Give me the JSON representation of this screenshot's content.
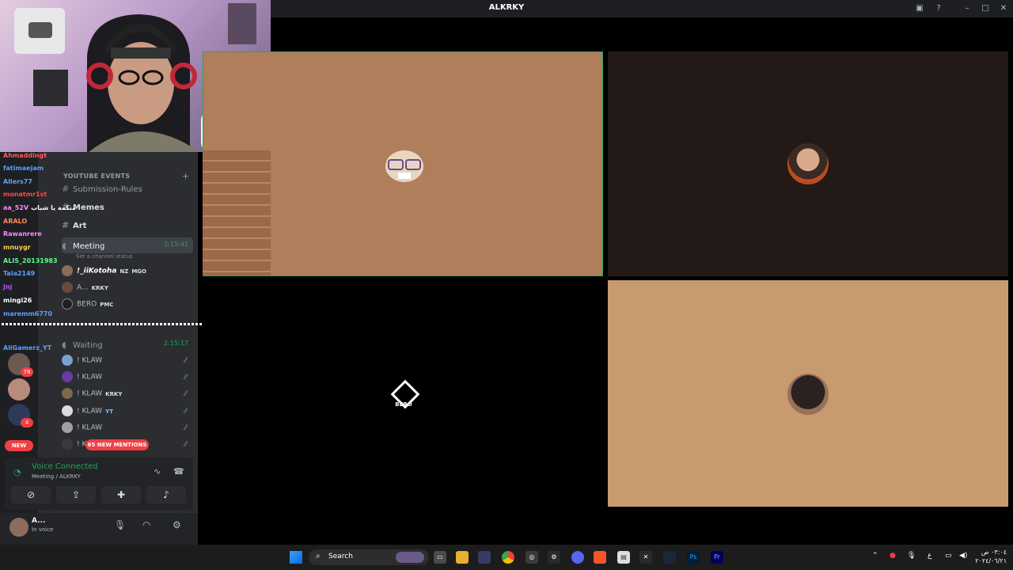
{
  "window": {
    "title": "ALKRKY"
  },
  "sidebar": {
    "category": "YOUTUBE EVENTS",
    "channels": [
      {
        "name": "Submission-Rules",
        "type": "text"
      },
      {
        "name": "Memes",
        "type": "text"
      },
      {
        "name": "Art",
        "type": "text"
      },
      {
        "name": "Meeting",
        "type": "voice",
        "time": "2:15:41"
      },
      {
        "name": "Waiting",
        "type": "voice",
        "time": "2:15:17"
      }
    ],
    "channel_status": "Set a channel status",
    "meeting_users": [
      {
        "name": "!_iiKotoha",
        "tags": "NZ",
        "role": "MGO"
      },
      {
        "name": "A...",
        "role": "KRKY"
      },
      {
        "name": "BERO",
        "role": "PMC"
      }
    ],
    "waiting_users": [
      {
        "name": "! KLAW",
        "role": ""
      },
      {
        "name": "! KLAW",
        "role": ""
      },
      {
        "name": "! KLAW",
        "role": "KRKY"
      },
      {
        "name": "! KLAW",
        "role": "YT"
      },
      {
        "name": "! KLAW",
        "role": ""
      },
      {
        "name": "! KL",
        "role": ""
      }
    ],
    "server_badges": [
      "78",
      "4"
    ],
    "new_label": "NEW",
    "mentions_label": "65 NEW MENTIONS"
  },
  "voice": {
    "status": "Voice Connected",
    "location": "Meeting / ALKRKY"
  },
  "user_panel": {
    "name": "A...",
    "status": "In voice"
  },
  "chat": [
    {
      "user": "Ahmaddingt",
      "msg": "",
      "color": "#ff5a5a"
    },
    {
      "user": "fatimaejam",
      "msg": "",
      "color": "#5aa0ff"
    },
    {
      "user": "Allers77",
      "msg": "",
      "color": "#5aa0ff"
    },
    {
      "user": "monatmr1st",
      "msg": "",
      "color": "#ff4a4a"
    },
    {
      "user": "aa_52V",
      "msg": "متكمة يا شباب",
      "color": "#ff88ff"
    },
    {
      "user": "ARALO",
      "msg": "",
      "color": "#ff8a5a"
    },
    {
      "user": "Rawanrere",
      "msg": "",
      "color": "#ff88ff"
    },
    {
      "user": "mnuygr",
      "msg": "",
      "color": "#ffd24a"
    },
    {
      "user": "ALIS_20131983",
      "msg": "",
      "color": "#5aff8a"
    },
    {
      "user": "Tala2149",
      "msg": "",
      "color": "#5aa0ff"
    },
    {
      "user": "Jnj",
      "msg": "",
      "color": "#b35aff"
    },
    {
      "user": "mingi26",
      "msg": "",
      "color": "#ffffff"
    },
    {
      "user": "maremm6770",
      "msg": "",
      "color": "#5aa0ff"
    },
    {
      "user": "AliGamerz_YT",
      "msg": "",
      "color": "#5aa0ff"
    }
  ],
  "tiles": {
    "bero_label": "BERO"
  },
  "taskbar": {
    "search_label": "Search",
    "lang": "ع",
    "time": "٠٣:٠٤ ص",
    "date": "٢٠٢٤/٠٦/٢١"
  }
}
